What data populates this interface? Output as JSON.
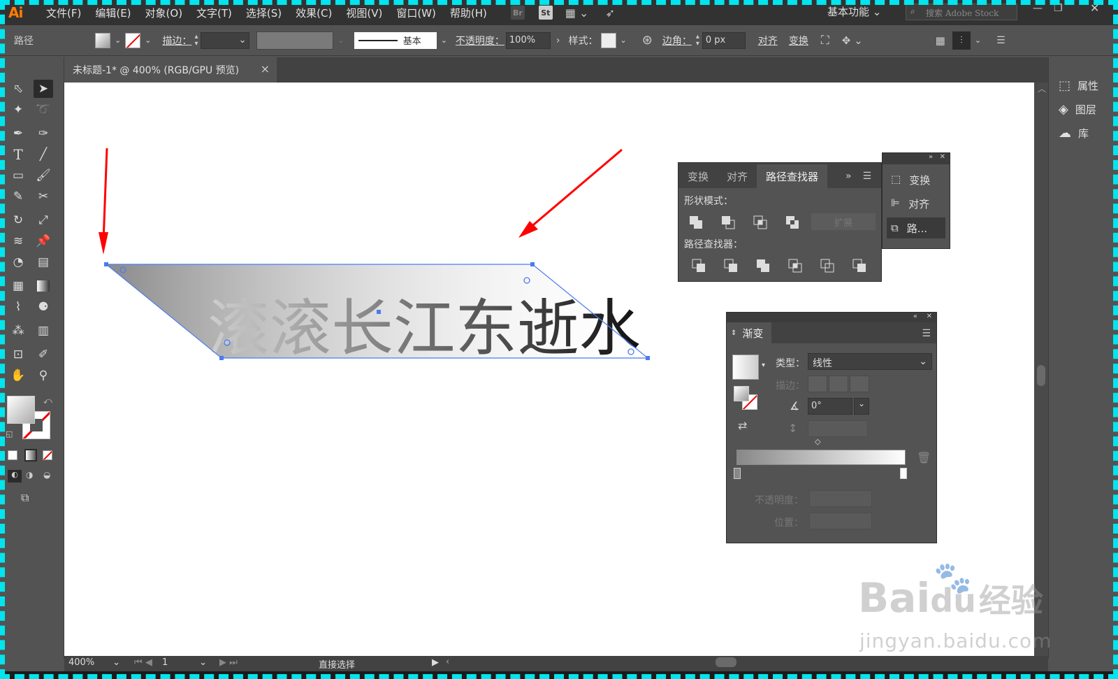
{
  "app": {
    "logo": "Ai"
  },
  "menu": [
    "文件(F)",
    "编辑(E)",
    "对象(O)",
    "文字(T)",
    "选择(S)",
    "效果(C)",
    "视图(V)",
    "窗口(W)",
    "帮助(H)"
  ],
  "bridge_tags": {
    "br": "Br",
    "st": "St"
  },
  "workspace": "基本功能",
  "search_placeholder": "搜索 Adobe Stock",
  "control_bar": {
    "object_type": "路径",
    "stroke_label": "描边：",
    "stroke_profile": "基本",
    "opacity_label": "不透明度：",
    "opacity_value": "100%",
    "style_label": "样式：",
    "corner_label": "边角：",
    "corner_value": "0 px",
    "align": "对齐",
    "transform": "变换"
  },
  "document_tab": {
    "title": "未标题-1* @ 400% (RGB/GPU 预览)",
    "close": "×"
  },
  "canvas": {
    "text": "滚滚长江东逝水"
  },
  "right_panel": {
    "items": [
      {
        "label": "属性",
        "icon": "properties-icon"
      },
      {
        "label": "图层",
        "icon": "layers-icon"
      },
      {
        "label": "库",
        "icon": "libraries-icon"
      }
    ]
  },
  "pathfinder_panel": {
    "tabs": [
      "变换",
      "对齐",
      "路径查找器"
    ],
    "shape_modes_label": "形状模式：",
    "expand_label": "扩展",
    "pathfinders_label": "路径查找器："
  },
  "mini_panel": {
    "items": [
      "变换",
      "对齐",
      "路..."
    ]
  },
  "gradient_panel": {
    "title": "渐变",
    "type_label": "类型：",
    "type_value": "线性",
    "stroke_label": "描边：",
    "angle_value": "0°",
    "opacity_label": "不透明度：",
    "position_label": "位置："
  },
  "status": {
    "zoom": "400%",
    "page": "1",
    "tool": "直接选择"
  },
  "watermark": {
    "brand": "Bai",
    "du": "du",
    "jy": "经验",
    "url": "jingyan.baidu.com"
  },
  "colors": {
    "accent_arrow": "#ff0000",
    "selection": "#4a7bf0",
    "frame": "#00e5ee"
  }
}
